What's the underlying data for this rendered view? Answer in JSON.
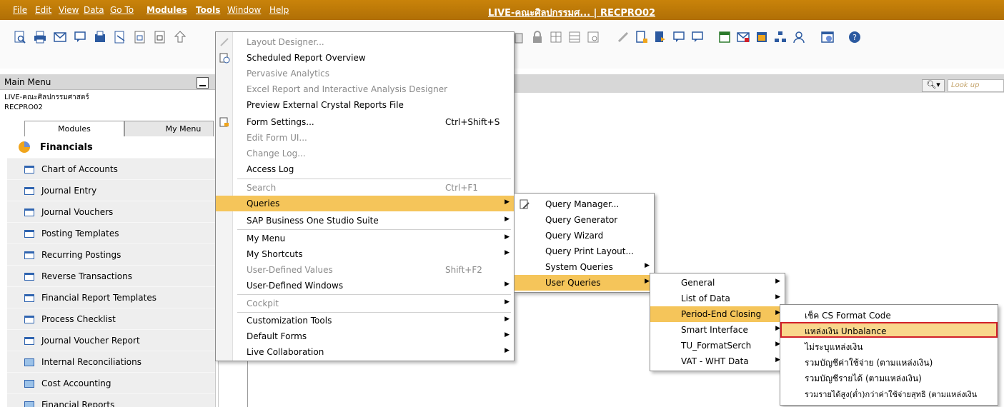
{
  "menubar": {
    "items": [
      "File",
      "Edit",
      "View",
      "Data",
      "Go To",
      "Modules",
      "Tools",
      "Window",
      "Help"
    ],
    "title": "LIVE-คณะศิลปกรรมศ... | RECPRO02"
  },
  "left_panel": {
    "header": "Main Menu",
    "company_line1": "LIVE-คณะศิลปกรรมศาสตร์",
    "company_line2": "RECPRO02",
    "tabs": [
      "Modules",
      "My Menu"
    ],
    "module": "Financials",
    "items": [
      {
        "label": "Chart of Accounts",
        "icon": "document-icon"
      },
      {
        "label": "Journal Entry",
        "icon": "document-icon"
      },
      {
        "label": "Journal Vouchers",
        "icon": "document-icon"
      },
      {
        "label": "Posting Templates",
        "icon": "document-icon"
      },
      {
        "label": "Recurring Postings",
        "icon": "document-icon"
      },
      {
        "label": "Reverse Transactions",
        "icon": "document-icon"
      },
      {
        "label": "Financial Report Templates",
        "icon": "document-icon"
      },
      {
        "label": "Process Checklist",
        "icon": "document-icon"
      },
      {
        "label": "Journal Voucher Report",
        "icon": "document-icon"
      },
      {
        "label": "Internal Reconciliations",
        "icon": "folder-icon"
      },
      {
        "label": "Cost Accounting",
        "icon": "folder-icon"
      },
      {
        "label": "Financial Reports",
        "icon": "folder-icon"
      }
    ]
  },
  "search": {
    "placeholder": "Look up"
  },
  "tools_menu": {
    "items": [
      {
        "label": "Layout Designer...",
        "disabled": true
      },
      {
        "label": "Scheduled Report Overview"
      },
      {
        "label": "Pervasive Analytics",
        "disabled": true
      },
      {
        "label": "Excel Report and Interactive Analysis Designer",
        "disabled": true
      },
      {
        "label": "Preview External Crystal Reports File"
      },
      {
        "label": "Form Settings...",
        "shortcut": "Ctrl+Shift+S"
      },
      {
        "label": "Edit Form UI...",
        "disabled": true
      },
      {
        "label": "Change Log...",
        "disabled": true
      },
      {
        "label": "Access Log"
      },
      {
        "label": "Search",
        "shortcut": "Ctrl+F1",
        "disabled": true
      },
      {
        "label": "Queries",
        "submenu": true
      },
      {
        "label": "SAP Business One Studio Suite",
        "submenu": true
      },
      {
        "label": "My Menu",
        "submenu": true
      },
      {
        "label": "My Shortcuts",
        "submenu": true
      },
      {
        "label": "User-Defined Values",
        "shortcut": "Shift+F2",
        "disabled": true
      },
      {
        "label": "User-Defined Windows",
        "submenu": true
      },
      {
        "label": "Cockpit",
        "submenu": true,
        "disabled": true
      },
      {
        "label": "Customization Tools",
        "submenu": true
      },
      {
        "label": "Default Forms",
        "submenu": true
      },
      {
        "label": "Live Collaboration",
        "submenu": true
      }
    ]
  },
  "queries_menu": {
    "items": [
      "Query Manager...",
      "Query Generator",
      "Query Wizard",
      "Query Print Layout...",
      "System Queries",
      "User Queries"
    ]
  },
  "user_queries_menu": {
    "items": [
      "General",
      "List of Data",
      "Period-End Closing",
      "Smart Interface",
      "TU_FormatSerch",
      "VAT - WHT Data"
    ]
  },
  "period_end_menu": {
    "items": [
      "เช็ค CS Format Code",
      "แหล่งเงิน Unbalance",
      "ไม่ระบุแหล่งเงิน",
      "รวมบัญชีค่าใช้จ่าย (ตามแหล่งเงิน)",
      "รวมบัญชีรายได้ (ตามแหล่งเงิน)",
      "รวมรายได้สูง(ต่ำ)กว่าค่าใช้จ่ายสุทธิ (ตามแหล่งเงิน"
    ]
  },
  "colors": {
    "menubar": "#b97a08",
    "highlight": "#f5c55a",
    "selection_box": "#d2202a"
  }
}
